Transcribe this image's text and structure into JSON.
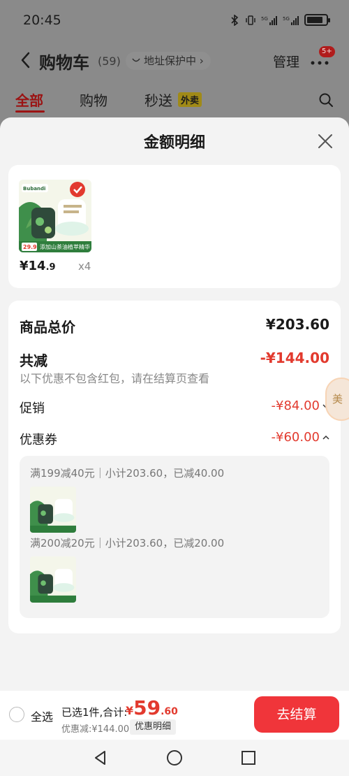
{
  "status": {
    "time": "20:45",
    "sig1": "5G",
    "sig2": "5G"
  },
  "header": {
    "title": "购物车",
    "count": "(59)",
    "address_protect": "地址保护中",
    "manage": "管理",
    "badge": "5+"
  },
  "tabs": {
    "all": "全部",
    "shop": "购物",
    "flash": "秒送",
    "flash_badge": "外卖"
  },
  "sheet": {
    "title": "金额明细",
    "item": {
      "price_main": "¥14",
      "price_dec": ".9",
      "qty": "x4"
    },
    "totals": {
      "goods_label": "商品总价",
      "goods_value": "¥203.60",
      "reduce_label": "共减",
      "reduce_value": "-¥144.00",
      "note": "以下优惠不包含红包，请在结算页查看",
      "promo_label": "促销",
      "promo_value": "-¥84.00",
      "coupon_label": "优惠券",
      "coupon_value": "-¥60.00"
    },
    "coupons": [
      {
        "text": "满199减40元｜小计203.60，已减40.00"
      },
      {
        "text": "满200减20元｜小计203.60，已减20.00"
      }
    ],
    "side_avatar": "美"
  },
  "bottom": {
    "select_all": "全选",
    "summary": "已选1件,合计:",
    "total_cur": "¥",
    "total_big": "59",
    "total_dec": ".60",
    "discount": "优惠减:¥144.00",
    "detail_btn": "优惠明细",
    "checkout": "去结算"
  },
  "product_image": {
    "brand": "Bubandi",
    "tag": "29.9",
    "caption": "添加山茶油植萃精华"
  },
  "colors": {
    "accent": "#e23a2e",
    "checkout_bg": "#f0353a"
  }
}
